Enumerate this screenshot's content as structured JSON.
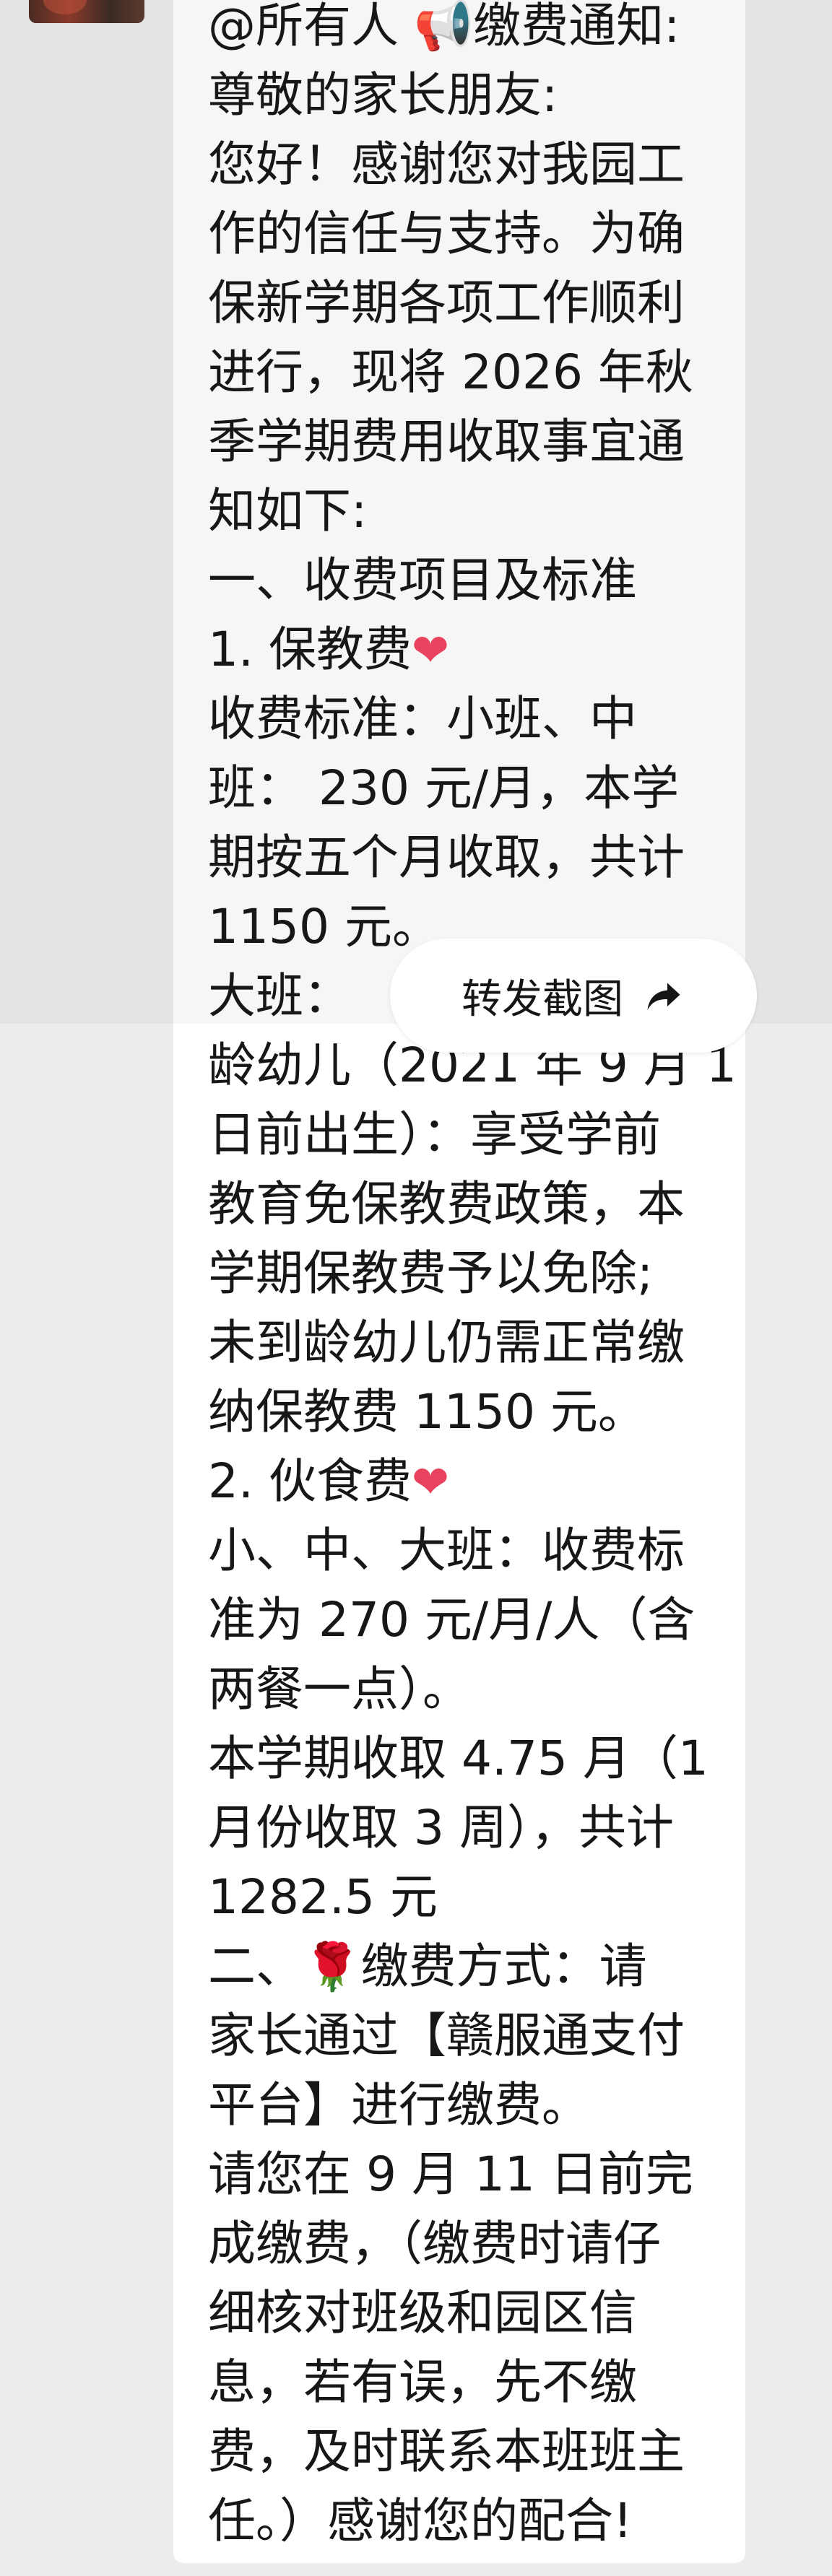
{
  "message": {
    "lines": [
      "@所有人 📢缴费通知:",
      "尊敬的家长朋友:",
      "您好！感谢您对我园工",
      "作的信任与支持。为确",
      "保新学期各项工作顺利",
      "进行，现将 2026 年秋",
      "季学期费用收取事宜通",
      "知如下:",
      "一、收费项目及标准",
      "1. 保教费",
      "收费标准：小班、中",
      "班： 230 元/月，本学",
      "期按五个月收取，共计",
      "1150 元。",
      "大班：",
      "龄幼儿（2021 年 9 月 1",
      "日前出生）：享受学前",
      "教育免保教费政策，本",
      "学期保教费予以免除;",
      "未到龄幼儿仍需正常缴",
      "纳保教费 1150 元。",
      "2. 伙食费",
      "小、中、大班：收费标",
      "准为 270 元/月/人（含",
      "两餐一点）。",
      "本学期收取 4.75 月（1",
      "月份收取 3 周），共计",
      "1282.5 元",
      "二、",
      "缴费方式：请",
      "家长通过【赣服通支付",
      "平台】进行缴费。",
      "请您在 9 月 11 日前完",
      "成缴费，（缴费时请仔",
      "细核对班级和园区信",
      "息，若有误，先不缴",
      "费，及时联系本班班主",
      "任。）感谢您的配合!"
    ]
  },
  "emoji": {
    "heart": "❤",
    "rose": "🌹"
  },
  "forward_pill": {
    "label": "转发截图",
    "icon": "share-arrow-icon"
  },
  "colors": {
    "bubble": "#ffffff",
    "text": "#171717",
    "heart": "#e8425e",
    "rose": "#d61f2c"
  }
}
